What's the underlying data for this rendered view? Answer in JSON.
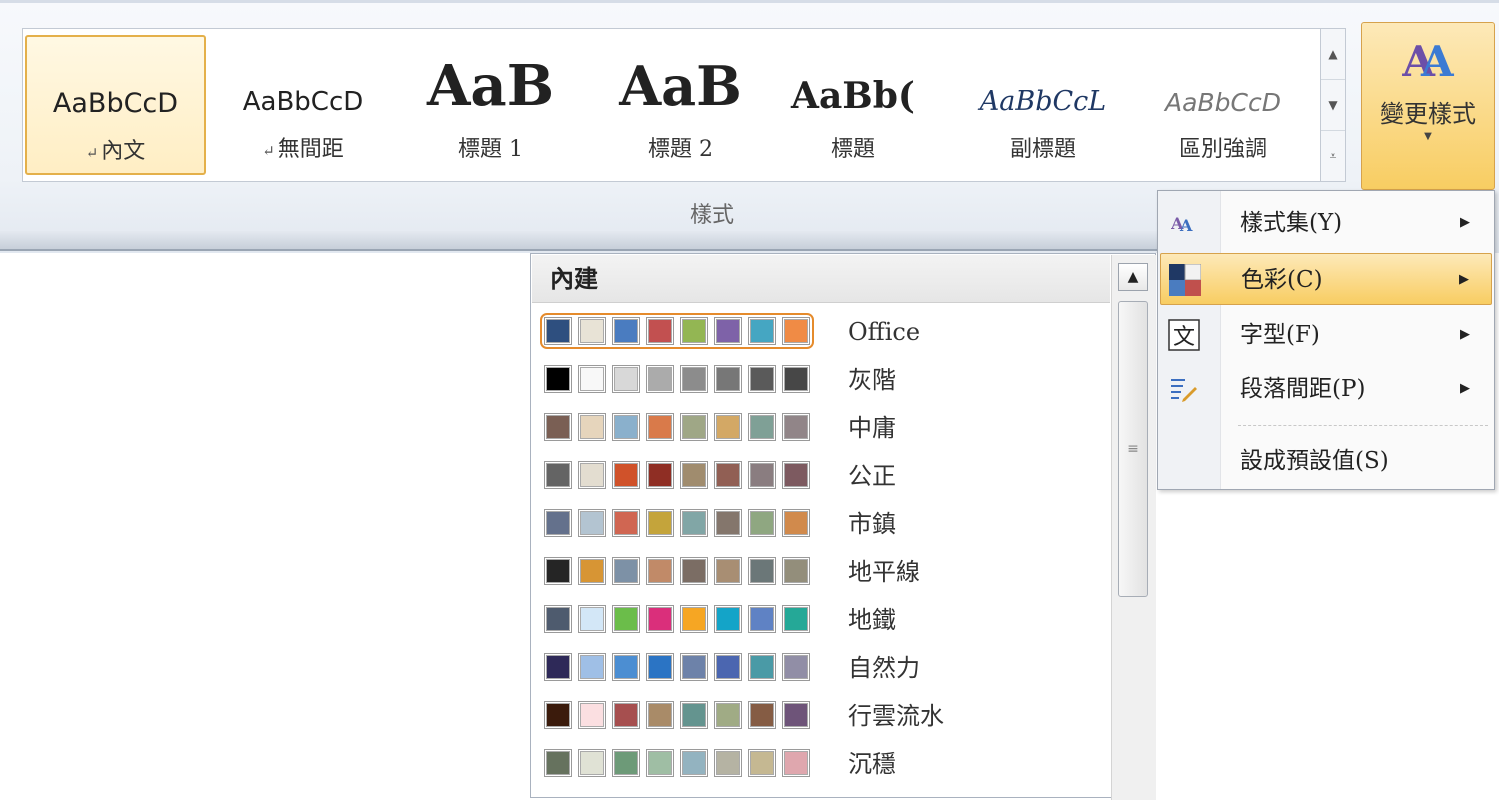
{
  "ribbon": {
    "group_label": "樣式",
    "change_styles_label": "變更樣式",
    "styles": [
      {
        "preview": "AaBbCcD",
        "label": "內文",
        "selected": true,
        "ret": true
      },
      {
        "preview": "AaBbCcD",
        "label": "無間距",
        "selected": false,
        "ret": true
      },
      {
        "preview": "AaB",
        "label": "標題 1",
        "selected": false,
        "ret": false
      },
      {
        "preview": "AaB",
        "label": "標題 2",
        "selected": false,
        "ret": false
      },
      {
        "preview": "AaBb(",
        "label": "標題",
        "selected": false,
        "ret": false
      },
      {
        "preview": "AaBbCcL",
        "label": "副標題",
        "selected": false,
        "ret": false
      },
      {
        "preview": "AaBbCcD",
        "label": "區別強調",
        "selected": false,
        "ret": false
      }
    ],
    "return_mark": "↵"
  },
  "color_panel": {
    "header": "內建",
    "themes": [
      {
        "name": "Office",
        "colors": [
          "#2e4f7f",
          "#e8e3d6",
          "#4a7cc0",
          "#c25050",
          "#93b653",
          "#7e62a8",
          "#45a6c2",
          "#f08b45"
        ],
        "selected": true
      },
      {
        "name": "灰階",
        "colors": [
          "#000000",
          "#f8f8f8",
          "#d8d8d8",
          "#ababab",
          "#8c8c8c",
          "#777777",
          "#5a5a5a",
          "#474747"
        ],
        "selected": false
      },
      {
        "name": "中庸",
        "colors": [
          "#7a5f54",
          "#e6d5bc",
          "#8ab0cc",
          "#d97a4a",
          "#9fa786",
          "#d3a865",
          "#7fa096",
          "#918588"
        ],
        "selected": false
      },
      {
        "name": "公正",
        "colors": [
          "#646464",
          "#e3ddd0",
          "#d0522a",
          "#8f2e24",
          "#a08c6e",
          "#915f54",
          "#8a7d80",
          "#7d5a60"
        ],
        "selected": false
      },
      {
        "name": "市鎮",
        "colors": [
          "#64718c",
          "#b3c4d1",
          "#d06652",
          "#c4a43b",
          "#81a6a6",
          "#84766c",
          "#8fa781",
          "#d18a4c"
        ],
        "selected": false
      },
      {
        "name": "地平線",
        "colors": [
          "#252525",
          "#d79534",
          "#7d91a6",
          "#c18a68",
          "#7b6d64",
          "#a88e73",
          "#6b7778",
          "#938e7b"
        ],
        "selected": false
      },
      {
        "name": "地鐵",
        "colors": [
          "#4e5b6e",
          "#d3e7f7",
          "#6bbd4a",
          "#da2f7b",
          "#f6a623",
          "#14a4c8",
          "#5f82c4",
          "#25a897"
        ],
        "selected": false
      },
      {
        "name": "自然力",
        "colors": [
          "#2e2958",
          "#9fbfe6",
          "#4c8ed2",
          "#2b74c4",
          "#6d82a9",
          "#4b66b0",
          "#4a9aa6",
          "#918ea6"
        ],
        "selected": false
      },
      {
        "name": "行雲流水",
        "colors": [
          "#3b1b0c",
          "#fbdfe1",
          "#a64f4f",
          "#a98b68",
          "#64948f",
          "#a0ab85",
          "#855c44",
          "#6e5479"
        ],
        "selected": false
      },
      {
        "name": "沉穩",
        "colors": [
          "#66725e",
          "#e0e2d5",
          "#6d9a78",
          "#9fbea4",
          "#93b3c0",
          "#b5b3a3",
          "#c5b892",
          "#dfa7ae"
        ],
        "selected": false
      }
    ]
  },
  "menu": {
    "items": [
      {
        "label": "樣式集(Y)",
        "icon": "style-set-icon",
        "arrow": true,
        "highlight": false
      },
      {
        "label": "色彩(C)",
        "icon": "color-palette-icon",
        "arrow": true,
        "highlight": true
      },
      {
        "label": "字型(F)",
        "icon": "font-icon",
        "arrow": true,
        "highlight": false
      },
      {
        "label": "段落間距(P)",
        "icon": "paragraph-spacing-icon",
        "arrow": true,
        "highlight": false
      },
      {
        "label": "設成預設值(S)",
        "icon": "",
        "arrow": false,
        "highlight": false
      }
    ],
    "arrow_glyph": "▶"
  }
}
